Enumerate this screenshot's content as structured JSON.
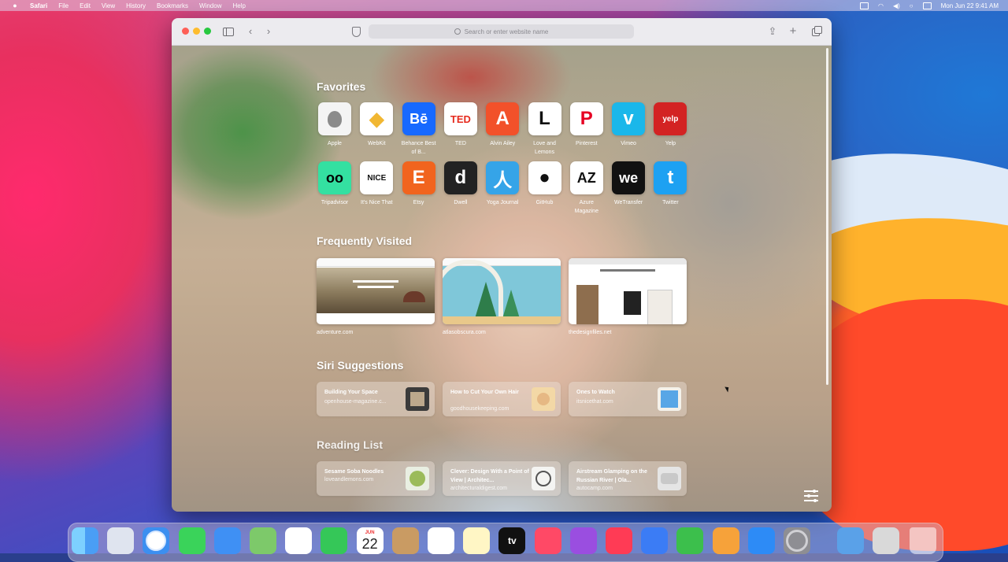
{
  "menubar": {
    "app_name": "Safari",
    "items": [
      "File",
      "Edit",
      "View",
      "History",
      "Bookmarks",
      "Window",
      "Help"
    ],
    "clock": "Mon Jun 22  9:41 AM"
  },
  "toolbar": {
    "address_placeholder": "Search or enter website name"
  },
  "start_page": {
    "favorites_title": "Favorites",
    "favorites": [
      {
        "label": "Apple",
        "icon": "apple-icon",
        "bg": "#f4f4f4",
        "fg": "#8b8b8b",
        "glyph": ""
      },
      {
        "label": "WebKit",
        "icon": "webkit-icon",
        "bg": "#ffffff",
        "fg": "#f1b732",
        "glyph": "◆"
      },
      {
        "label": "Behance Best of B...",
        "icon": "behance-icon",
        "bg": "#1769ff",
        "fg": "#ffffff",
        "glyph": "Bē"
      },
      {
        "label": "TED",
        "icon": "ted-icon",
        "bg": "#ffffff",
        "fg": "#e62b1e",
        "glyph": "TED"
      },
      {
        "label": "Alvin Ailey",
        "icon": "alvin-ailey-icon",
        "bg": "#f2512a",
        "fg": "#ffffff",
        "glyph": "A"
      },
      {
        "label": "Love and Lemons",
        "icon": "love-and-lemons-icon",
        "bg": "#ffffff",
        "fg": "#111111",
        "glyph": "L"
      },
      {
        "label": "Pinterest",
        "icon": "pinterest-icon",
        "bg": "#ffffff",
        "fg": "#e60023",
        "glyph": "P"
      },
      {
        "label": "Vimeo",
        "icon": "vimeo-icon",
        "bg": "#1ab7ea",
        "fg": "#ffffff",
        "glyph": "v"
      },
      {
        "label": "Yelp",
        "icon": "yelp-icon",
        "bg": "#d32323",
        "fg": "#ffffff",
        "glyph": "yelp"
      },
      {
        "label": "Tripadvisor",
        "icon": "tripadvisor-icon",
        "bg": "#34e0a1",
        "fg": "#000000",
        "glyph": "oo"
      },
      {
        "label": "It's Nice That",
        "icon": "its-nice-that-icon",
        "bg": "#ffffff",
        "fg": "#111111",
        "glyph": "NICE"
      },
      {
        "label": "Etsy",
        "icon": "etsy-icon",
        "bg": "#f1641e",
        "fg": "#ffffff",
        "glyph": "E"
      },
      {
        "label": "Dwell",
        "icon": "dwell-icon",
        "bg": "#222222",
        "fg": "#ffffff",
        "glyph": "d"
      },
      {
        "label": "Yoga Journal",
        "icon": "yoga-journal-icon",
        "bg": "#35a4e8",
        "fg": "#ffffff",
        "glyph": "人"
      },
      {
        "label": "GitHub",
        "icon": "github-icon",
        "bg": "#ffffff",
        "fg": "#111111",
        "glyph": "●"
      },
      {
        "label": "Azure Magazine",
        "icon": "azure-magazine-icon",
        "bg": "#ffffff",
        "fg": "#111111",
        "glyph": "AZ"
      },
      {
        "label": "WeTransfer",
        "icon": "wetransfer-icon",
        "bg": "#111111",
        "fg": "#ffffff",
        "glyph": "we"
      },
      {
        "label": "Twitter",
        "icon": "twitter-icon",
        "bg": "#1da1f2",
        "fg": "#ffffff",
        "glyph": "t"
      }
    ],
    "frequently_visited_title": "Frequently Visited",
    "frequently_visited": [
      {
        "url": "adventure.com"
      },
      {
        "url": "atlasobscura.com"
      },
      {
        "url": "thedesignfiles.net"
      }
    ],
    "siri_title": "Siri Suggestions",
    "siri_suggestions": [
      {
        "title": "Building Your Space",
        "source": "openhouse-magazine.c..."
      },
      {
        "title": "How to Cut Your Own Hair",
        "source": "goodhousekeeping.com"
      },
      {
        "title": "Ones to Watch",
        "source": "itsnicethat.com"
      }
    ],
    "reading_list_title": "Reading List",
    "reading_list": [
      {
        "title": "Sesame Soba Noodles",
        "source": "loveandlemons.com"
      },
      {
        "title": "Clever: Design With a Point of View | Architec...",
        "source": "architecturaldigest.com"
      },
      {
        "title": "Airstream Glamping on the Russian River | Ola...",
        "source": "autocamp.com"
      }
    ]
  },
  "dock": {
    "apps": [
      "finder-icon",
      "launchpad-icon",
      "safari-icon",
      "messages-icon",
      "mail-icon",
      "maps-icon",
      "photos-icon",
      "facetime-icon",
      "calendar-icon",
      "contacts-icon",
      "reminders-icon",
      "notes-icon",
      "tv-icon",
      "music-icon",
      "podcasts-icon",
      "news-icon",
      "keynote-icon",
      "numbers-icon",
      "pages-icon",
      "app-store-icon",
      "system-preferences-icon",
      "downloads-folder-icon",
      "documents-folder-icon",
      "trash-icon"
    ],
    "calendar_month": "JUN",
    "calendar_day": "22",
    "tv_label": "tv"
  }
}
